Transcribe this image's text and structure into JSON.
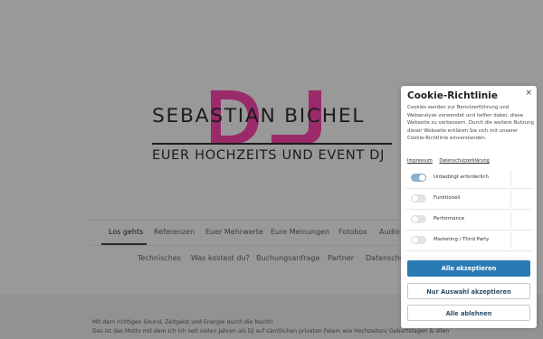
{
  "site": {
    "logo": {
      "name": "SEBASTIAN BICHEL",
      "monogram": "DJ",
      "tagline": "EUER HOCHZEITS UND EVENT DJ",
      "monogram_color": "#9a2a6a"
    },
    "nav": {
      "primary": [
        "Los gehts",
        "Referenzen",
        "Euer Mehrwerte",
        "Eure Meinungen",
        "Fotobox",
        "Audio"
      ],
      "secondary": [
        "Technisches",
        "Was kostest du?",
        "Buchungsanfrage",
        "Partner",
        "Datenschu"
      ],
      "active": "Los gehts"
    },
    "copy": [
      "Mit dem richtigen Sound, Zeitgeist und Energie durch die Nacht!",
      "Das ist das Motto mit dem ich ich seit vielen Jahren als DJ auf sämtlichen privaten Feiern wie Hochzeiten/ Geburtstagen & allen"
    ]
  },
  "cookie": {
    "title": "Cookie-Richtlinie",
    "close_icon": "×",
    "description": "Cookies werden zur Benutzerführung und Webanalyse verwendet und helfen dabei, diese Webseite zu verbessern. Durch die weitere Nutzung dieser Webseite erklären Sie sich mit unserer Cookie-Richtlinie einverstanden.",
    "links": [
      "Impressum",
      "Datenschutzerklärung"
    ],
    "categories": [
      {
        "label": "Unbedingt erforderlich",
        "enabled": true
      },
      {
        "label": "Funktionell",
        "enabled": false
      },
      {
        "label": "Performance",
        "enabled": false
      },
      {
        "label": "Marketing / Third Party",
        "enabled": false
      }
    ],
    "buttons": {
      "accept_all": "Alle akzeptieren",
      "accept_selection": "Nur Auswahl akzeptieren",
      "reject_all": "Alle ablehnen"
    },
    "accent_color": "#2a7ab4"
  }
}
